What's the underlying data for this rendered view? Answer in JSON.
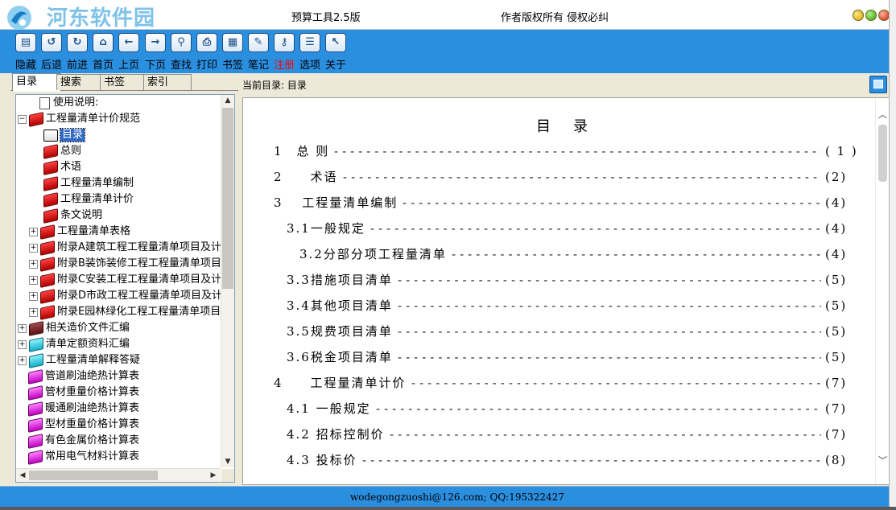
{
  "titlebar": {
    "watermark": "河东软件园",
    "title": "预算工具2.5版",
    "copyright": "作者版权所有  侵权必纠"
  },
  "toolbar": {
    "items": [
      {
        "label": "隐藏",
        "icon": "hide-icon",
        "glyph": "▤"
      },
      {
        "label": "后退",
        "icon": "back-icon",
        "glyph": "↺"
      },
      {
        "label": "前进",
        "icon": "forward-icon",
        "glyph": "↻"
      },
      {
        "label": "首页",
        "icon": "home-icon",
        "glyph": "⌂"
      },
      {
        "label": "上页",
        "icon": "prev-page-icon",
        "glyph": "←"
      },
      {
        "label": "下页",
        "icon": "next-page-icon",
        "glyph": "→"
      },
      {
        "label": "查找",
        "icon": "search-icon",
        "glyph": "⚲"
      },
      {
        "label": "打印",
        "icon": "print-icon",
        "glyph": "⎙"
      },
      {
        "label": "书签",
        "icon": "bookmark-icon",
        "glyph": "▦"
      },
      {
        "label": "笔记",
        "icon": "note-icon",
        "glyph": "✎"
      },
      {
        "label": "注册",
        "icon": "register-key-icon",
        "glyph": "⚷",
        "highlight": true
      },
      {
        "label": "选项",
        "icon": "options-icon",
        "glyph": "☰"
      },
      {
        "label": "关于",
        "icon": "about-icon",
        "glyph": "↖"
      }
    ]
  },
  "tabs": [
    {
      "label": "目录",
      "active": true
    },
    {
      "label": "搜索",
      "active": false
    },
    {
      "label": "书签",
      "active": false
    },
    {
      "label": "索引",
      "active": false
    }
  ],
  "tree": [
    {
      "level": 1,
      "expander": "",
      "icon": "doc",
      "label": "使用说明:"
    },
    {
      "level": 0,
      "expander": "−",
      "icon": "red",
      "label": "工程量清单计价规范"
    },
    {
      "level": 2,
      "expander": "",
      "icon": "open",
      "label": "目录",
      "selected": true
    },
    {
      "level": 2,
      "expander": "",
      "icon": "red",
      "label": "总则"
    },
    {
      "level": 2,
      "expander": "",
      "icon": "red",
      "label": "术语"
    },
    {
      "level": 2,
      "expander": "",
      "icon": "red",
      "label": "工程量清单编制"
    },
    {
      "level": 2,
      "expander": "",
      "icon": "red",
      "label": "工程量清单计价"
    },
    {
      "level": 2,
      "expander": "",
      "icon": "red",
      "label": "条文说明"
    },
    {
      "level": 1,
      "expander": "+",
      "icon": "red",
      "label": "工程量清单表格"
    },
    {
      "level": 1,
      "expander": "+",
      "icon": "red",
      "label": "附录A建筑工程工程量清单项目及计算"
    },
    {
      "level": 1,
      "expander": "+",
      "icon": "red",
      "label": "附录B装饰装修工程工程量清单项目及"
    },
    {
      "level": 1,
      "expander": "+",
      "icon": "red",
      "label": "附录C安装工程工程量清单项目及计算"
    },
    {
      "level": 1,
      "expander": "+",
      "icon": "red",
      "label": "附录D市政工程工程量清单项目及计算"
    },
    {
      "level": 1,
      "expander": "+",
      "icon": "red",
      "label": "附录E园林绿化工程工程量清单项目及"
    },
    {
      "level": 0,
      "expander": "+",
      "icon": "dark",
      "label": "相关造价文件汇编"
    },
    {
      "level": 0,
      "expander": "+",
      "icon": "cyan",
      "label": "清单定额资料汇编"
    },
    {
      "level": 0,
      "expander": "+",
      "icon": "cyan",
      "label": "工程量清单解释答疑"
    },
    {
      "level": 0,
      "expander": "",
      "icon": "magenta",
      "label": "管道刷油绝热计算表"
    },
    {
      "level": 0,
      "expander": "",
      "icon": "magenta",
      "label": "管材重量价格计算表"
    },
    {
      "level": 0,
      "expander": "",
      "icon": "magenta",
      "label": "暖通刷油绝热计算表"
    },
    {
      "level": 0,
      "expander": "",
      "icon": "magenta",
      "label": "型材重量价格计算表"
    },
    {
      "level": 0,
      "expander": "",
      "icon": "magenta",
      "label": "有色金属价格计算表"
    },
    {
      "level": 0,
      "expander": "",
      "icon": "magenta",
      "label": "常用电气材料计算表"
    }
  ],
  "breadcrumb": "当前目录: 目录",
  "content": {
    "title": "目录",
    "rows": [
      {
        "label": "1　总 则",
        "page": "( 1 )",
        "indent": 0
      },
      {
        "label": "2　　术语",
        "page": "(2)",
        "indent": 0
      },
      {
        "label": "3　 工程量清单编制",
        "page": "(4)",
        "indent": 0
      },
      {
        "label": "3.1一般规定",
        "page": "(4)",
        "indent": 1
      },
      {
        "label": "3.2分部分项工程量清单",
        "page": "(4)",
        "indent": 2
      },
      {
        "label": "3.3措施项目清单",
        "page": "(5)",
        "indent": 1
      },
      {
        "label": "3.4其他项目清单",
        "page": "(5)",
        "indent": 1
      },
      {
        "label": "3.5规费项目清单",
        "page": "(5)",
        "indent": 1
      },
      {
        "label": "3.6税金项目清单",
        "page": "(5)",
        "indent": 1
      },
      {
        "label": "4　　工程量清单计价",
        "page": "(7)",
        "indent": 0
      },
      {
        "label": "4.1 一般规定",
        "page": "(7)",
        "indent": 1
      },
      {
        "label": "4.2 招标控制价",
        "page": "(7)",
        "indent": 1
      },
      {
        "label": "4.3 投标价",
        "page": "(8)",
        "indent": 1
      }
    ]
  },
  "status": {
    "text": "wodegongzuoshi@126.com; QQ:195322427"
  },
  "colors": {
    "toolbar": "#2b8fe0",
    "selection": "#316ac5",
    "register": "#ff0000"
  }
}
